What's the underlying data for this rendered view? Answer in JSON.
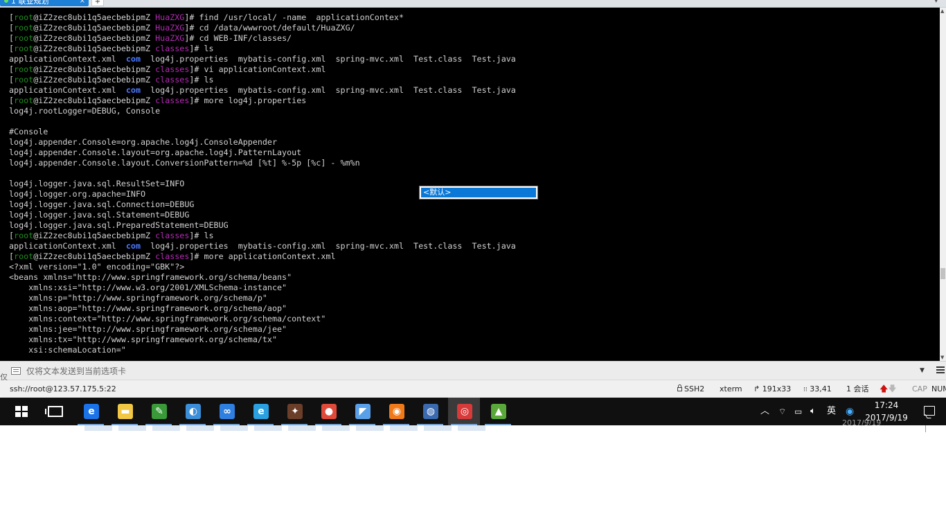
{
  "tab": {
    "title": "1 联业规划",
    "close_glyph": "×",
    "add_glyph": "+"
  },
  "terminal": {
    "lines": [
      [
        {
          "t": "[",
          "c": "d"
        },
        {
          "t": "root",
          "c": "u"
        },
        {
          "t": "@iZ2zec8ubi1q5aecbebipmZ ",
          "c": "d"
        },
        {
          "t": "HuaZXG",
          "c": "p"
        },
        {
          "t": "]# find /usr/local/ -name  applicationContex*",
          "c": "d"
        }
      ],
      [
        {
          "t": "[",
          "c": "d"
        },
        {
          "t": "root",
          "c": "u"
        },
        {
          "t": "@iZ2zec8ubi1q5aecbebipmZ ",
          "c": "d"
        },
        {
          "t": "HuaZXG",
          "c": "p"
        },
        {
          "t": "]# cd /data/wwwroot/default/HuaZXG/",
          "c": "d"
        }
      ],
      [
        {
          "t": "[",
          "c": "d"
        },
        {
          "t": "root",
          "c": "u"
        },
        {
          "t": "@iZ2zec8ubi1q5aecbebipmZ ",
          "c": "d"
        },
        {
          "t": "HuaZXG",
          "c": "p"
        },
        {
          "t": "]# cd WEB-INF/classes/",
          "c": "d"
        }
      ],
      [
        {
          "t": "[",
          "c": "d"
        },
        {
          "t": "root",
          "c": "u"
        },
        {
          "t": "@iZ2zec8ubi1q5aecbebipmZ ",
          "c": "d"
        },
        {
          "t": "classes",
          "c": "p"
        },
        {
          "t": "]# ls",
          "c": "d"
        }
      ],
      [
        {
          "t": "applicationContext.xml  ",
          "c": "d"
        },
        {
          "t": "com",
          "c": "b"
        },
        {
          "t": "  log4j.properties  mybatis-config.xml  spring-mvc.xml  Test.class  Test.java",
          "c": "d"
        }
      ],
      [
        {
          "t": "[",
          "c": "d"
        },
        {
          "t": "root",
          "c": "u"
        },
        {
          "t": "@iZ2zec8ubi1q5aecbebipmZ ",
          "c": "d"
        },
        {
          "t": "classes",
          "c": "p"
        },
        {
          "t": "]# vi applicationContext.xml",
          "c": "d"
        }
      ],
      [
        {
          "t": "[",
          "c": "d"
        },
        {
          "t": "root",
          "c": "u"
        },
        {
          "t": "@iZ2zec8ubi1q5aecbebipmZ ",
          "c": "d"
        },
        {
          "t": "classes",
          "c": "p"
        },
        {
          "t": "]# ls",
          "c": "d"
        }
      ],
      [
        {
          "t": "applicationContext.xml  ",
          "c": "d"
        },
        {
          "t": "com",
          "c": "b"
        },
        {
          "t": "  log4j.properties  mybatis-config.xml  spring-mvc.xml  Test.class  Test.java",
          "c": "d"
        }
      ],
      [
        {
          "t": "[",
          "c": "d"
        },
        {
          "t": "root",
          "c": "u"
        },
        {
          "t": "@iZ2zec8ubi1q5aecbebipmZ ",
          "c": "d"
        },
        {
          "t": "classes",
          "c": "p"
        },
        {
          "t": "]# more log4j.properties",
          "c": "d"
        }
      ],
      [
        {
          "t": "log4j.rootLogger=DEBUG, Console",
          "c": "d"
        }
      ],
      [
        {
          "t": "",
          "c": "d"
        }
      ],
      [
        {
          "t": "#Console",
          "c": "d"
        }
      ],
      [
        {
          "t": "log4j.appender.Console=org.apache.log4j.ConsoleAppender",
          "c": "d"
        }
      ],
      [
        {
          "t": "log4j.appender.Console.layout=org.apache.log4j.PatternLayout",
          "c": "d"
        }
      ],
      [
        {
          "t": "log4j.appender.Console.layout.ConversionPattern=%d [%t] %-5p [%c] - %m%n",
          "c": "d"
        }
      ],
      [
        {
          "t": "",
          "c": "d"
        }
      ],
      [
        {
          "t": "log4j.logger.java.sql.ResultSet=INFO",
          "c": "d"
        }
      ],
      [
        {
          "t": "log4j.logger.org.apache=INFO",
          "c": "d"
        }
      ],
      [
        {
          "t": "log4j.logger.java.sql.Connection=DEBUG",
          "c": "d"
        }
      ],
      [
        {
          "t": "log4j.logger.java.sql.Statement=DEBUG",
          "c": "d"
        }
      ],
      [
        {
          "t": "log4j.logger.java.sql.PreparedStatement=DEBUG",
          "c": "d"
        }
      ],
      [
        {
          "t": "[",
          "c": "d"
        },
        {
          "t": "root",
          "c": "u"
        },
        {
          "t": "@iZ2zec8ubi1q5aecbebipmZ ",
          "c": "d"
        },
        {
          "t": "classes",
          "c": "p"
        },
        {
          "t": "]# ls",
          "c": "d"
        }
      ],
      [
        {
          "t": "applicationContext.xml  ",
          "c": "d"
        },
        {
          "t": "com",
          "c": "b"
        },
        {
          "t": "  log4j.properties  mybatis-config.xml  spring-mvc.xml  Test.class  Test.java",
          "c": "d"
        }
      ],
      [
        {
          "t": "[",
          "c": "d"
        },
        {
          "t": "root",
          "c": "u"
        },
        {
          "t": "@iZ2zec8ubi1q5aecbebipmZ ",
          "c": "d"
        },
        {
          "t": "classes",
          "c": "p"
        },
        {
          "t": "]# more applicationContext.xml",
          "c": "d"
        }
      ],
      [
        {
          "t": "<?xml version=\"1.0\" encoding=\"GBK\"?>",
          "c": "d"
        }
      ],
      [
        {
          "t": "<beans xmlns=\"http://www.springframework.org/schema/beans\"",
          "c": "d"
        }
      ],
      [
        {
          "t": "    xmlns:xsi=\"http://www.w3.org/2001/XMLSchema-instance\"",
          "c": "d"
        }
      ],
      [
        {
          "t": "    xmlns:p=\"http://www.springframework.org/schema/p\"",
          "c": "d"
        }
      ],
      [
        {
          "t": "    xmlns:aop=\"http://www.springframework.org/schema/aop\"",
          "c": "d"
        }
      ],
      [
        {
          "t": "    xmlns:context=\"http://www.springframework.org/schema/context\"",
          "c": "d"
        }
      ],
      [
        {
          "t": "    xmlns:jee=\"http://www.springframework.org/schema/jee\"",
          "c": "d"
        }
      ],
      [
        {
          "t": "    xmlns:tx=\"http://www.springframework.org/schema/tx\"",
          "c": "d"
        }
      ],
      [
        {
          "t": "    xsi:schemaLocation=\"",
          "c": "d"
        }
      ]
    ],
    "ime_candidate": "<默认>"
  },
  "sendbar": {
    "left_mark": "仅",
    "placeholder": "仅将文本发送到当前选项卡"
  },
  "status": {
    "connection": "ssh://root@123.57.175.5:22",
    "protocol": "SSH2",
    "term_type": "xterm",
    "size_glyph": "↱",
    "size": "191x33",
    "cursor": "33,41",
    "sessions": "1 会话",
    "cap": "CAP",
    "num": "NUM"
  },
  "taskbar": {
    "apps": [
      {
        "name": "edge-app-icon",
        "glyph": "e",
        "color": "#1a73e8"
      },
      {
        "name": "file-explorer-icon",
        "glyph": "▬",
        "color": "#f2c744"
      },
      {
        "name": "notepad-app-icon",
        "glyph": "✎",
        "color": "#3a9a3a"
      },
      {
        "name": "paint-app-icon",
        "glyph": "◐",
        "color": "#3b8fd9"
      },
      {
        "name": "baidu-netdisk-icon",
        "glyph": "∞",
        "color": "#2f7fe0"
      },
      {
        "name": "ie-browser-icon",
        "glyph": "e",
        "color": "#2aa0e0"
      },
      {
        "name": "game-app-icon",
        "glyph": "✦",
        "color": "#6b3e2a"
      },
      {
        "name": "chrome-browser-icon",
        "glyph": "●",
        "color": "#e04a3a"
      },
      {
        "name": "mysql-dolphin-icon",
        "glyph": "◤",
        "color": "#5aa0e8"
      },
      {
        "name": "firefox-browser-icon",
        "glyph": "◉",
        "color": "#f07a1a"
      },
      {
        "name": "globe-app-icon",
        "glyph": "◍",
        "color": "#3a6ab0"
      },
      {
        "name": "xshell-app-icon",
        "glyph": "◎",
        "color": "#d83a3a"
      },
      {
        "name": "green-app-icon",
        "glyph": "▲",
        "color": "#5aa83a"
      }
    ],
    "ime_lang": "英",
    "time": "17:24",
    "date": "2017/9/19",
    "residue_date": "2017/9/19"
  }
}
